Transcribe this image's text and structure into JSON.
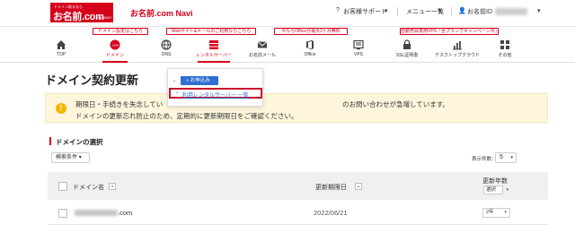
{
  "header": {
    "logo_tagline": "ドメイン取るなら",
    "logo_main": "お名前.com",
    "logo_sub": "by GMO",
    "nav_title": "お名前.com Navi",
    "support": "お客様サポート",
    "menu": "メニュー一覧",
    "user_id_label": "お名前ID"
  },
  "banners": [
    "ドメイン設定はこちら",
    "Webサイト&メールのご利用ならこちら",
    "今ならOfficeが最大2ヶ月無料",
    "自動売買専用VPS「全プランでキャンペーン中」"
  ],
  "gnav": [
    "TOP",
    "ドメイン",
    "DNS",
    "レンタルサーバー",
    "お名前メール",
    "Office",
    "VPS",
    "SSL証明書",
    "デスクトップクラウド",
    "その他"
  ],
  "page_title": "ドメイン契約更新",
  "alert": {
    "line1a": "期限日・手続きを失念してい",
    "line1b": "のお問い合わせが急増しています。",
    "line2": "ドメインの更新忘れ防止のため、定期的に更新期限日をご確認ください。"
  },
  "dropdown": {
    "apply": "お申込み",
    "list_link": "利用レンタルサーバー 一覧"
  },
  "section_title": "ドメインの選択",
  "filter_label": "検索条件",
  "count_label": "表示件数：",
  "count_value": "5",
  "table": {
    "col_domain": "ドメイン名",
    "col_expiry": "更新期限日",
    "col_years": "更新年数",
    "col_years_select": "選択",
    "rows": [
      {
        "domain_tld": ".com",
        "expiry": "2022/06/21",
        "years": "2年"
      }
    ]
  },
  "colors": {
    "brand_red": "#d6001c",
    "link_blue": "#2f6fd1",
    "alert_bg": "#fdf6dc"
  }
}
